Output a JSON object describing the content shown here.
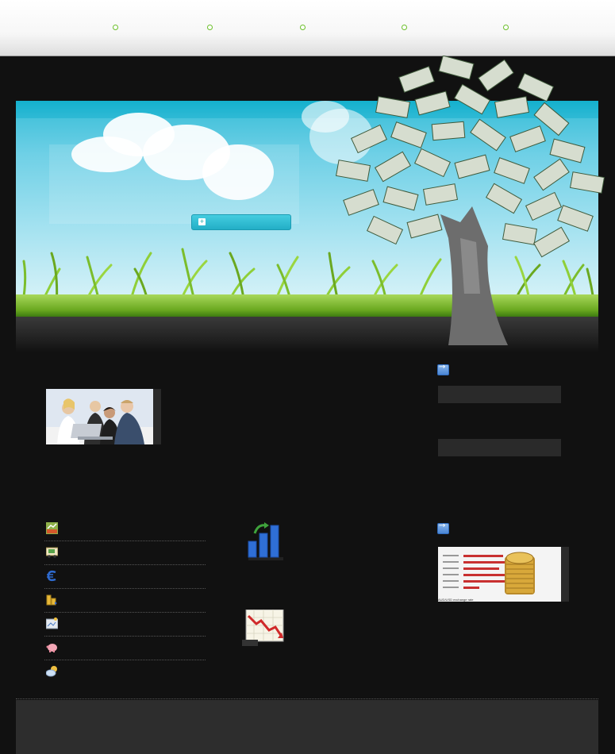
{
  "nav": {
    "items": [
      {
        "label": ""
      },
      {
        "label": ""
      },
      {
        "label": ""
      },
      {
        "label": ""
      },
      {
        "label": ""
      }
    ]
  },
  "hero": {
    "button_label": ""
  },
  "sidebar": {
    "widgets": [
      {
        "icon": "arrow-right-icon",
        "title": ""
      },
      {
        "icon": "arrow-right-icon",
        "title": ""
      }
    ]
  },
  "list": {
    "items": [
      {
        "icon": "chart-icon",
        "label": ""
      },
      {
        "icon": "truck-icon",
        "label": ""
      },
      {
        "icon": "euro-icon",
        "label": ""
      },
      {
        "icon": "coins-stack-icon",
        "label": ""
      },
      {
        "icon": "image-icon",
        "label": ""
      },
      {
        "icon": "piggy-bank-icon",
        "label": ""
      },
      {
        "icon": "weather-icon",
        "label": ""
      }
    ]
  },
  "coins_image_caption": "AUD/USD exchange rate"
}
